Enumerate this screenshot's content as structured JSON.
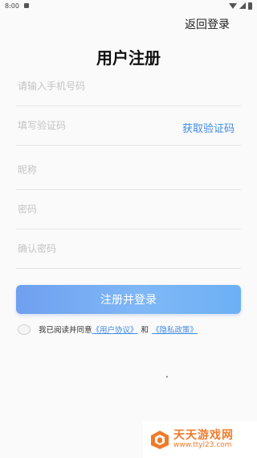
{
  "status_bar": {
    "time": "8:00"
  },
  "header": {
    "back_login": "返回登录",
    "title": "用户注册"
  },
  "form": {
    "phone_placeholder": "请输入手机号码",
    "code_placeholder": "填写验证码",
    "get_code": "获取验证码",
    "nickname_placeholder": "昵称",
    "password_placeholder": "密码",
    "confirm_password_placeholder": "确认密码",
    "submit": "注册并登录"
  },
  "agreement": {
    "prefix": "我已阅读并同意",
    "user_agreement": "《用户协议》",
    "and": "和",
    "privacy_policy": "《隐私政策》"
  },
  "watermark": {
    "title": "天天游戏网",
    "url": "www.ttyl23.com"
  },
  "colors": {
    "accent": "#3d8be4",
    "button_start": "#6fa0f0",
    "button_end": "#6db0f5",
    "watermark": "#f07a2a"
  }
}
